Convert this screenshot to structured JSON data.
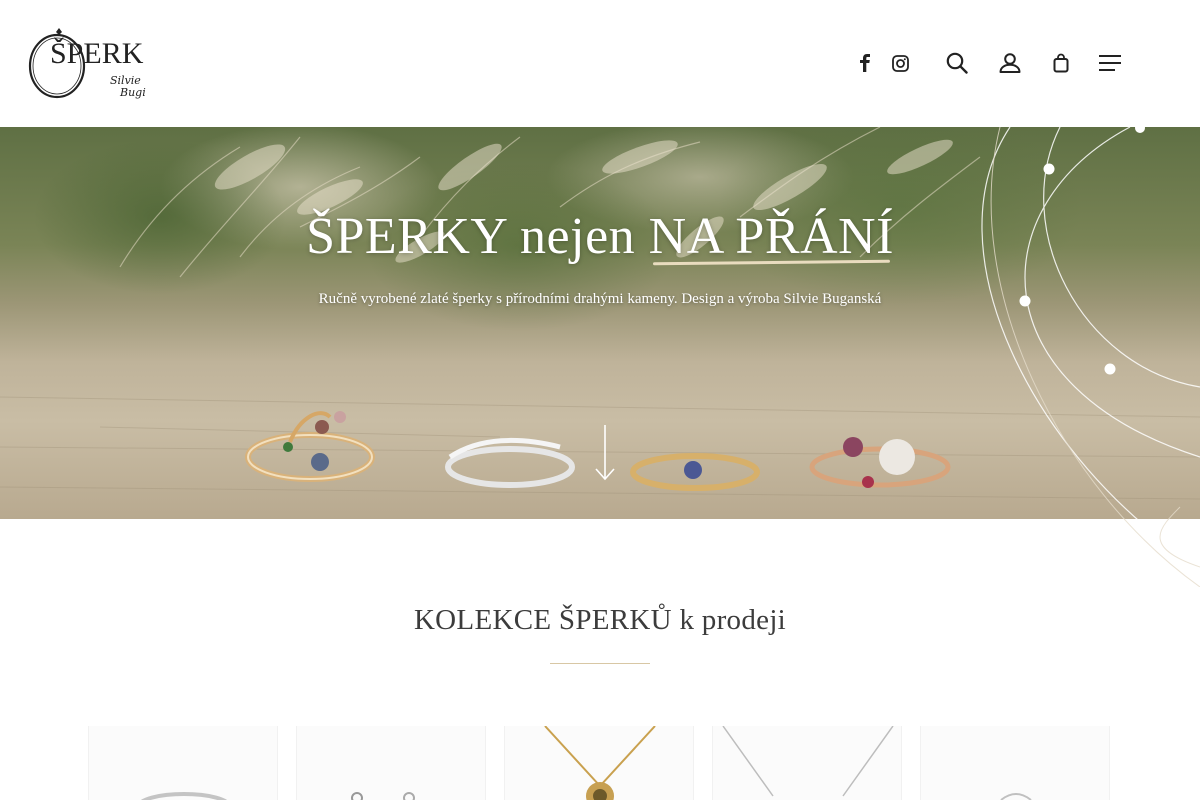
{
  "header": {
    "logo_text": "ŠPERK",
    "logo_signature": "Silvie Bugi",
    "icons": [
      "facebook-icon",
      "instagram-icon",
      "search-icon",
      "account-icon",
      "cart-icon",
      "menu-icon"
    ]
  },
  "hero": {
    "title_part1": "ŠPERKY nejen ",
    "title_part2": "NA PŘÁNÍ",
    "subtitle": "Ručně vyrobené zlaté šperky s přírodními drahými kameny. Design a výroba Silvie Buganská"
  },
  "collection": {
    "title": "KOLEKCE ŠPERKŮ k prodeji"
  },
  "colors": {
    "accent": "#d8c7a4",
    "text": "#3c3c3c",
    "icon": "#222222"
  }
}
